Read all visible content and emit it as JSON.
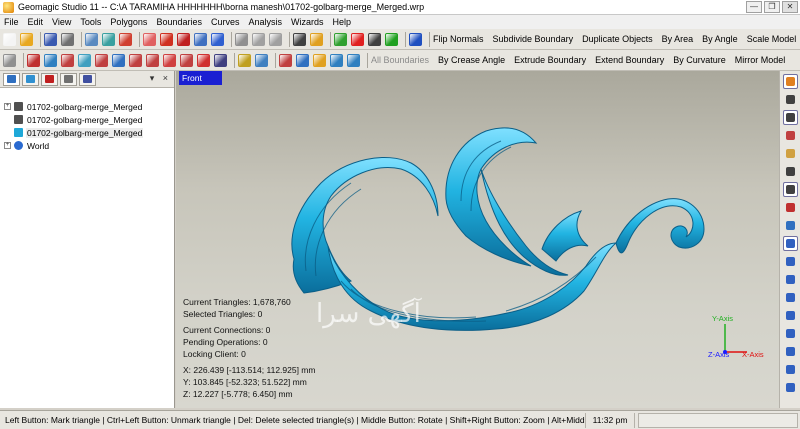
{
  "window": {
    "title": "Geomagic Studio 11 -- C:\\A TARAMIHA HHHHHHH\\borna manesh\\01702-golbarg-merge_Merged.wrp",
    "minimize": "—",
    "restore": "❐",
    "close": "✕"
  },
  "menu": [
    "File",
    "Edit",
    "View",
    "Tools",
    "Polygons",
    "Boundaries",
    "Curves",
    "Analysis",
    "Wizards",
    "Help"
  ],
  "toolbar1": {
    "icons": [
      {
        "name": "new-icon",
        "color": "#f4f4f4"
      },
      {
        "name": "open-icon",
        "color": "#e8a820"
      },
      {
        "name": "save-icon",
        "color": "#3a5ab0"
      },
      {
        "name": "import-icon",
        "color": "#707070"
      },
      {
        "name": "rotate-view-icon",
        "color": "#5a8ac0"
      },
      {
        "name": "pan-icon",
        "color": "#3aa0a0"
      },
      {
        "name": "fit-view-icon",
        "color": "#d04030"
      },
      {
        "name": "select-icon",
        "color": "#e06060"
      },
      {
        "name": "target-icon",
        "color": "#d03020"
      },
      {
        "name": "lasso-icon",
        "color": "#c02020"
      },
      {
        "name": "settings-icon",
        "color": "#4070c0"
      },
      {
        "name": "move-icon",
        "color": "#3060d0"
      },
      {
        "name": "zoom-window-icon",
        "color": "#909090"
      },
      {
        "name": "zoom-in-icon",
        "color": "#a0a0a0"
      },
      {
        "name": "zoom-out-icon",
        "color": "#a0a0a0"
      },
      {
        "name": "camera-icon",
        "color": "#404040"
      },
      {
        "name": "pencil-icon",
        "color": "#e0a020"
      },
      {
        "name": "macro-icon",
        "color": "#30a030"
      },
      {
        "name": "record-icon",
        "color": "#e02020"
      },
      {
        "name": "stop-icon",
        "color": "#404040"
      },
      {
        "name": "play-icon",
        "color": "#20a020"
      },
      {
        "name": "box-icon",
        "color": "#2050c0"
      }
    ],
    "commands": [
      "Flip Normals",
      "Subdivide Boundary",
      "Duplicate Objects",
      "By Area",
      "By Angle",
      "Scale Model"
    ]
  },
  "toolbar2": {
    "icons": [
      {
        "name": "delete-icon",
        "color": "#909090"
      },
      {
        "name": "mesh-doctor-icon",
        "color": "#c03030"
      },
      {
        "name": "fill-holes-icon",
        "color": "#3080c0"
      },
      {
        "name": "relax-icon",
        "color": "#c04040"
      },
      {
        "name": "decimate-icon",
        "color": "#40a0c0"
      },
      {
        "name": "smooth-icon",
        "color": "#c04040"
      },
      {
        "name": "sharpen-icon",
        "color": "#3070c0"
      },
      {
        "name": "shell-icon",
        "color": "#c04040"
      },
      {
        "name": "thicken-icon",
        "color": "#c04040"
      },
      {
        "name": "offset-icon",
        "color": "#d04040"
      },
      {
        "name": "trim-icon",
        "color": "#c04040"
      },
      {
        "name": "emboss-icon",
        "color": "#d03030"
      },
      {
        "name": "boolean-icon",
        "color": "#404080"
      },
      {
        "name": "sandpaper-icon",
        "color": "#c0a020"
      },
      {
        "name": "defeature-icon",
        "color": "#4080c0"
      },
      {
        "name": "cut-icon",
        "color": "#c04040"
      },
      {
        "name": "plane-icon",
        "color": "#3070c0"
      },
      {
        "name": "shade-icon",
        "color": "#e0a020"
      },
      {
        "name": "edit-boundary-icon",
        "color": "#3080c0"
      },
      {
        "name": "create-boundary-icon",
        "color": "#3080c0"
      }
    ],
    "disabled_command": "All Boundaries",
    "commands": [
      "By Crease Angle",
      "Extrude Boundary",
      "Extend Boundary",
      "By Curvature",
      "Mirror Model"
    ]
  },
  "panel": {
    "tabs": [
      {
        "name": "model-manager-tab",
        "color": "#3070c0"
      },
      {
        "name": "display-tab",
        "color": "#3090d0"
      },
      {
        "name": "selection-tab",
        "color": "#c02020"
      },
      {
        "name": "dialog-tab",
        "color": "#707070"
      },
      {
        "name": "grid-tab",
        "color": "#4050a0"
      }
    ],
    "controls": "▾ ×",
    "tree": [
      {
        "label": "01702-golbarg-merge_Merged",
        "expander": "+",
        "icon_color": "#505050"
      },
      {
        "label": "01702-golbarg-merge_Merged",
        "expander": "",
        "icon_color": "#505050"
      },
      {
        "label": "01702-golbarg-merge_Merged",
        "expander": "",
        "icon_color": "#1ea8d8",
        "selected": true
      },
      {
        "label": "World",
        "expander": "+",
        "icon_color": "#2a6ad0"
      }
    ]
  },
  "viewport": {
    "view_name": "Front",
    "model_color": "#1fa9d6",
    "watermark": "آگهی سرا",
    "stats": {
      "triangles": "Current Triangles: 1,678,760",
      "selected": "Selected Triangles: 0",
      "connections": "Current Connections: 0",
      "pending": "Pending Operations: 0",
      "locking": "Locking Client: 0",
      "x": "X: 226.439 [-113.514; 112.925] mm",
      "y": "Y: 103.845 [-52.323; 51.522] mm",
      "z": "Z: 12.227 [-5.778; 6.450] mm"
    },
    "axes": {
      "y": "Y-Axis",
      "z": "Z-Axis",
      "x": "X-Axis",
      "y_color": "#22b022",
      "z_color": "#1a1aff",
      "x_color": "#e01010"
    }
  },
  "rightbar": [
    {
      "name": "display-toggle-icon",
      "color": "#e08020",
      "boxed": true
    },
    {
      "name": "pointer-icon",
      "color": "#404040"
    },
    {
      "name": "select-rect-icon",
      "color": "#404040",
      "boxed": true
    },
    {
      "name": "paint-select-icon",
      "color": "#c04040"
    },
    {
      "name": "lasso-select-icon",
      "color": "#d0a040"
    },
    {
      "name": "line-select-icon",
      "color": "#404040"
    },
    {
      "name": "select-through-icon",
      "color": "#404040",
      "boxed": true
    },
    {
      "name": "select-visible-icon",
      "color": "#c03030"
    },
    {
      "name": "select-all-icon",
      "color": "#3070c0"
    },
    {
      "name": "view-iso-icon",
      "color": "#3060c0",
      "boxed": true
    },
    {
      "name": "view-front-icon",
      "color": "#3060c0"
    },
    {
      "name": "view-back-icon",
      "color": "#3060c0"
    },
    {
      "name": "view-top-icon",
      "color": "#3060c0"
    },
    {
      "name": "view-bottom-icon",
      "color": "#3060c0"
    },
    {
      "name": "view-left-icon",
      "color": "#3060c0"
    },
    {
      "name": "view-right-icon",
      "color": "#3060c0"
    },
    {
      "name": "view-normal-icon",
      "color": "#3060c0"
    },
    {
      "name": "view-custom-icon",
      "color": "#3060c0"
    }
  ],
  "status": {
    "text": "Left Button: Mark triangle | Ctrl+Left Button: Unmark triangle | Del: Delete selected triangle(s) | Middle Button: Rotate | Shift+Right Button: Zoom | Alt+Middle Button: Pan",
    "time": "11:32 pm"
  }
}
